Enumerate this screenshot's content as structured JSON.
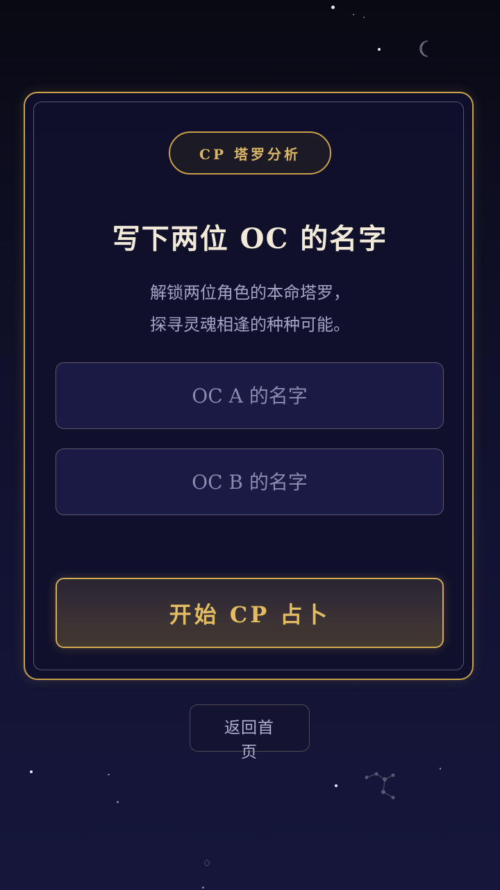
{
  "badge": {
    "label": "CP 塔罗分析"
  },
  "heading": {
    "title": "写下两位 OC 的名字"
  },
  "description": {
    "line1": "解锁两位角色的本命塔罗，",
    "line2": "探寻灵魂相逢的种种可能。"
  },
  "form": {
    "oc_a": {
      "placeholder": "OC A 的名字",
      "value": ""
    },
    "oc_b": {
      "placeholder": "OC B 的名字",
      "value": ""
    }
  },
  "actions": {
    "start_label": "开始 CP 占卜",
    "back_label": "返回首页"
  },
  "icons": [
    "moon-icon",
    "constellation-icon",
    "sparkle-icon"
  ],
  "colors": {
    "accent_gold": "#c9a24b",
    "background": "#0d0d1f",
    "field_background": "#1a1a45",
    "title_text": "#f2ead8",
    "muted_text": "#a7a3c7"
  }
}
